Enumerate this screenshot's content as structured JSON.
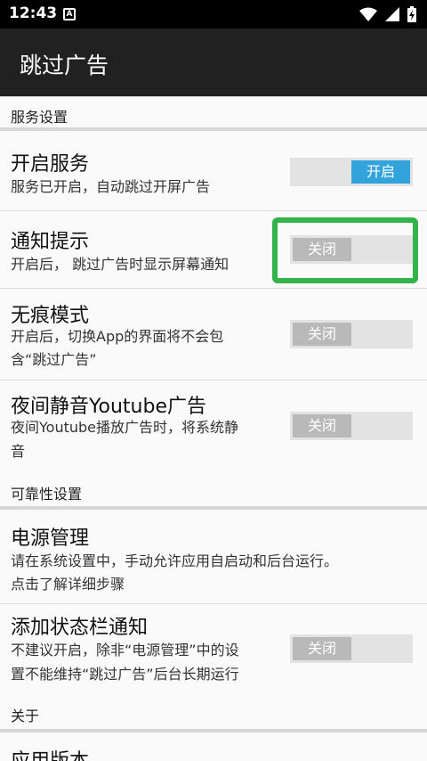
{
  "status_bar": {
    "time": "12:43",
    "notification_badge": "A",
    "icons": [
      "wifi-icon",
      "cell-signal-icon",
      "battery-charging-icon"
    ]
  },
  "app_bar": {
    "title": "跳过广告"
  },
  "sections": {
    "service": "服务设置",
    "reliability": "可靠性设置",
    "about": "关于"
  },
  "prefs": {
    "enable_service": {
      "title": "开启服务",
      "summary": "服务已开启，自动跳过开屏广告",
      "toggle_label": "开启",
      "on": true
    },
    "notify": {
      "title": "通知提示",
      "summary": "开启后， 跳过广告时显示屏幕通知",
      "toggle_label": "关闭",
      "on": false
    },
    "incognito": {
      "title": "无痕模式",
      "summary_line1": "开启后，切换App的界面将不会包",
      "summary_line2": "含“跳过广告”",
      "toggle_label": "关闭",
      "on": false
    },
    "youtube": {
      "title": "夜间静音Youtube广告",
      "summary_line1": "夜间Youtube播放广告时，将系统静",
      "summary_line2": "音",
      "toggle_label": "关闭",
      "on": false
    },
    "power": {
      "title": "电源管理",
      "summary_line1": "请在系统设置中，手动允许应用自启动和后台运行。",
      "summary_line2": "点击了解详细步骤"
    },
    "statusbar_notify": {
      "title": "添加状态栏通知",
      "summary_line1": "不建议开启，除非“电源管理”中的设",
      "summary_line2": "置不能维持“跳过广告”后台长期运行",
      "toggle_label": "关闭",
      "on": false
    },
    "app_version": {
      "title": "应用版本"
    }
  },
  "colors": {
    "status_bar": "#000000",
    "app_bar": "#212121",
    "toggle_on": "#33a3dc",
    "toggle_off_knob": "#b9b9b9",
    "toggle_track": "#e3e3e3",
    "highlight": "#34b34d"
  }
}
